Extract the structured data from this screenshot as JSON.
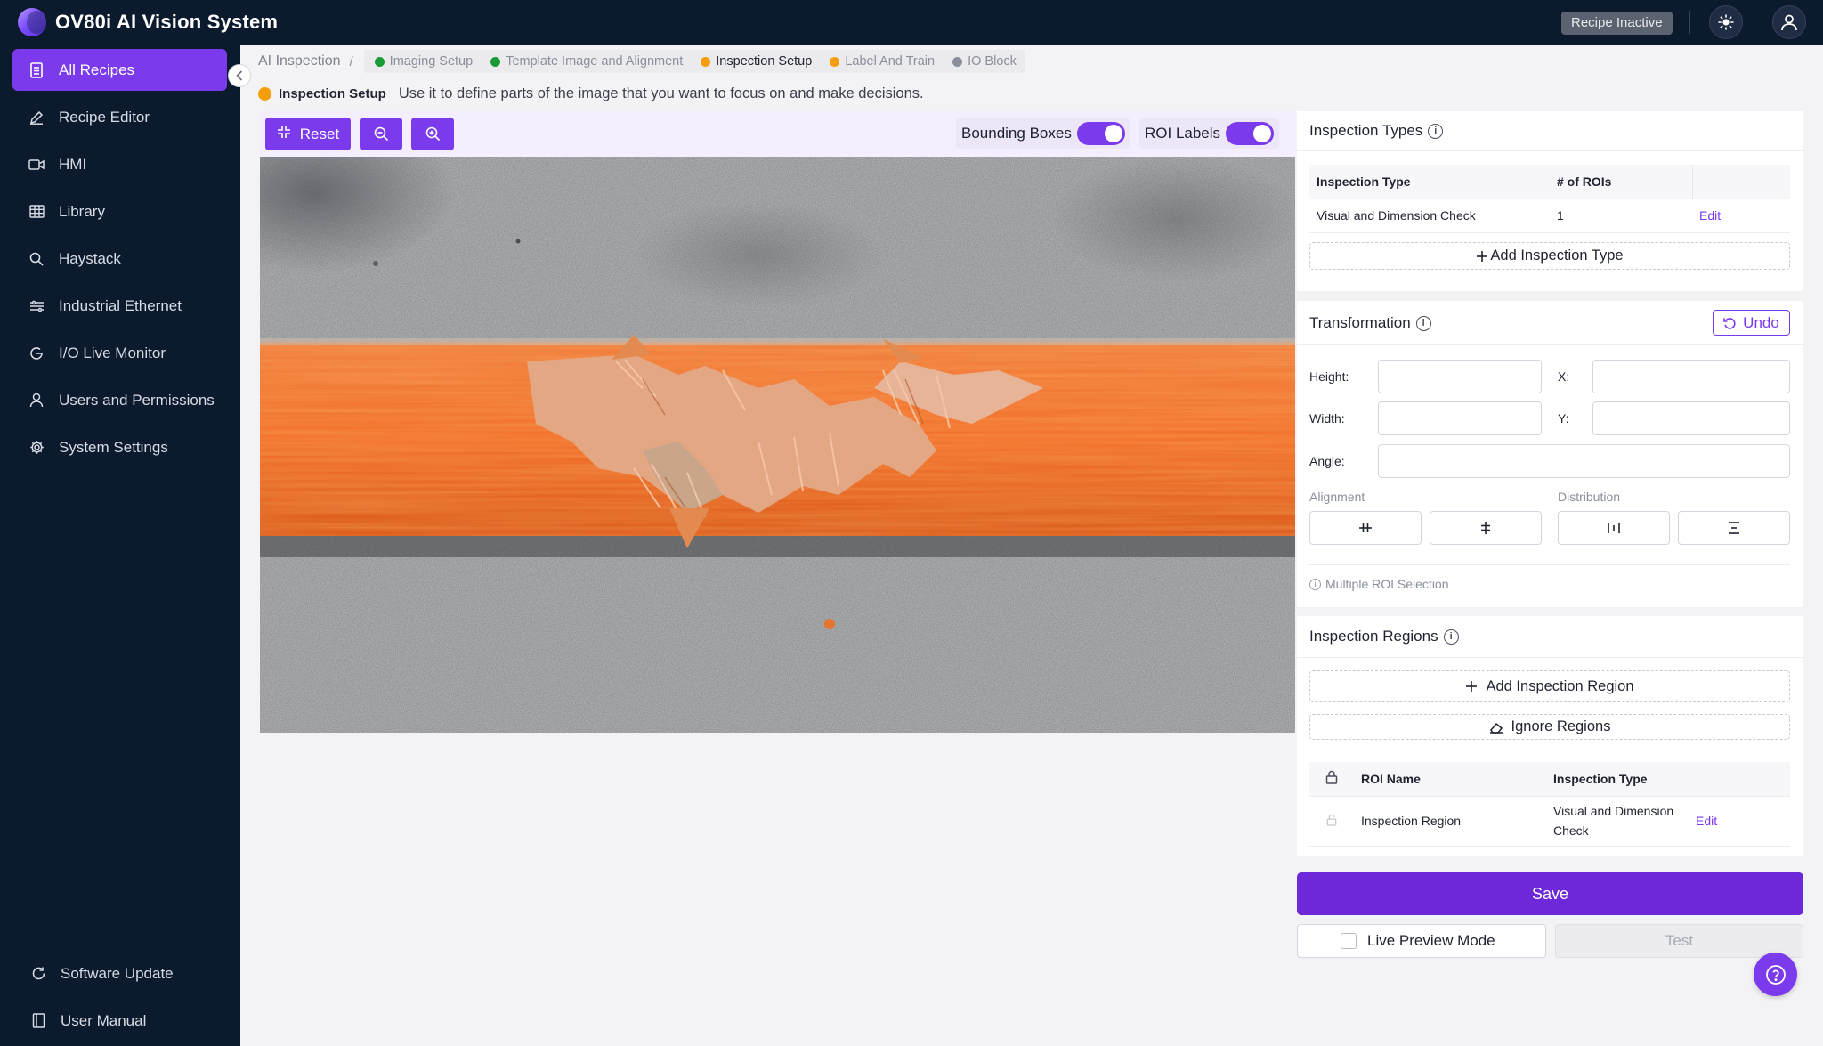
{
  "app": {
    "title": "OV80i AI Vision System",
    "recipe_status": "Recipe Inactive",
    "theme_icon": "sun-icon",
    "user_icon": "user-icon"
  },
  "sidebar": {
    "items": [
      {
        "label": "All Recipes",
        "icon": "document-icon",
        "active": true
      },
      {
        "label": "Recipe Editor",
        "icon": "pencil-icon"
      },
      {
        "label": "HMI",
        "icon": "video-icon"
      },
      {
        "label": "Library",
        "icon": "grid-icon"
      },
      {
        "label": "Haystack",
        "icon": "search-icon"
      },
      {
        "label": "Industrial Ethernet",
        "icon": "network-icon"
      },
      {
        "label": "I/O Live Monitor",
        "icon": "gauge-icon"
      },
      {
        "label": "Users and Permissions",
        "icon": "user-icon"
      },
      {
        "label": "System Settings",
        "icon": "gear-icon"
      }
    ],
    "bottom_items": [
      {
        "label": "Software Update",
        "icon": "refresh-icon"
      },
      {
        "label": "User Manual",
        "icon": "book-icon"
      }
    ]
  },
  "breadcrumb": {
    "root": "AI Inspection",
    "separator": "/",
    "steps": [
      {
        "label": "Imaging Setup",
        "color": "#1a9a35"
      },
      {
        "label": "Template Image and Alignment",
        "color": "#1a9a35"
      },
      {
        "label": "Inspection Setup",
        "color": "#f59e0b",
        "active": true
      },
      {
        "label": "Label And Train",
        "color": "#f59e0b"
      },
      {
        "label": "IO Block",
        "color": "#8a8f9b"
      }
    ]
  },
  "description": {
    "label": "Inspection Setup",
    "text": "Use it to define parts of the image that you want to focus on and make decisions.",
    "color": "#f59e0b"
  },
  "toolbar": {
    "reset_label": "Reset",
    "bounding_boxes_label": "Bounding Boxes",
    "bounding_boxes_on": true,
    "roi_labels_label": "ROI Labels",
    "roi_labels_on": true
  },
  "inspection_types": {
    "title": "Inspection Types",
    "headers": [
      "Inspection Type",
      "# of ROIs"
    ],
    "rows": [
      {
        "type": "Visual and Dimension Check",
        "rois": "1",
        "action": "Edit"
      }
    ],
    "add_label": "Add Inspection Type"
  },
  "transformation": {
    "title": "Transformation",
    "undo_label": "Undo",
    "height_label": "Height:",
    "width_label": "Width:",
    "angle_label": "Angle:",
    "x_label": "X:",
    "y_label": "Y:",
    "alignment_label": "Alignment",
    "distribution_label": "Distribution",
    "multi_roi_note": "Multiple ROI Selection"
  },
  "inspection_regions": {
    "title": "Inspection Regions",
    "add_region_label": "Add Inspection Region",
    "ignore_regions_label": "Ignore Regions",
    "headers": [
      "ROI Name",
      "Inspection Type"
    ],
    "rows": [
      {
        "name": "Inspection Region",
        "type": "Visual and Dimension Check",
        "action": "Edit"
      }
    ]
  },
  "footer": {
    "save_label": "Save",
    "live_preview_label": "Live Preview Mode",
    "test_label": "Test"
  },
  "colors": {
    "accent": "#7c3aed",
    "nav_bg": "#0c1a2e",
    "success": "#1a9a35",
    "warning": "#f59e0b"
  }
}
